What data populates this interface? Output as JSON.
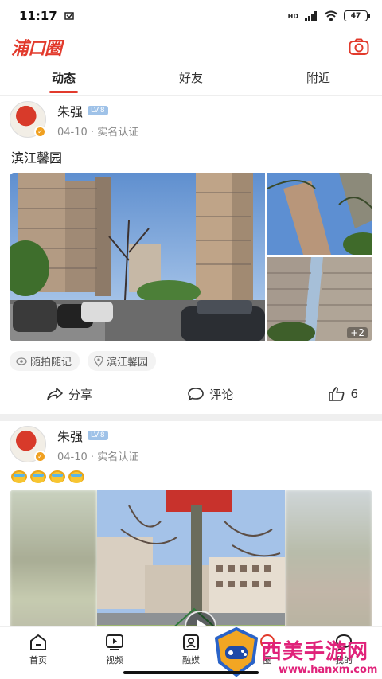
{
  "status_bar": {
    "time": "11:17",
    "battery": "47",
    "network": "HD"
  },
  "header": {
    "logo": "浦口圈"
  },
  "tabs": [
    {
      "label": "动态",
      "active": true
    },
    {
      "label": "好友",
      "active": false
    },
    {
      "label": "附近",
      "active": false
    }
  ],
  "posts": [
    {
      "user": "朱强",
      "level": "LV.8",
      "date": "04-10",
      "verify": "实名认证",
      "text": "滨江馨园",
      "more_images": "+2",
      "tags": [
        "随拍随记",
        "滨江馨园"
      ],
      "actions": {
        "share": "分享",
        "comment": "评论",
        "likes": "6"
      }
    },
    {
      "user": "朱强",
      "level": "LV.8",
      "date": "04-10",
      "verify": "实名认证",
      "emoji_count": 4
    }
  ],
  "bottom_nav": [
    {
      "label": "首页",
      "icon": "home-icon"
    },
    {
      "label": "视频",
      "icon": "video-icon"
    },
    {
      "label": "融媒",
      "icon": "media-icon"
    },
    {
      "label": "圈",
      "icon": "circle-icon"
    },
    {
      "label": "我的",
      "icon": "chat-icon"
    }
  ],
  "watermark": {
    "text": "西美手游网",
    "url": "www.hanxm.com"
  },
  "colors": {
    "accent": "#e23a2c",
    "level_badge": "#9fc2e8",
    "watermark": "#e0237a"
  }
}
